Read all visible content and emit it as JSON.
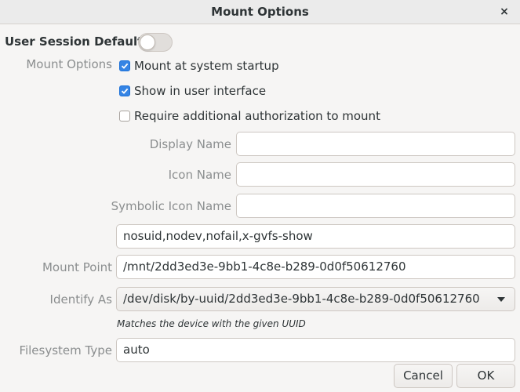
{
  "window": {
    "title": "Mount Options",
    "close_label": "×"
  },
  "session_defaults": {
    "label": "User Session Defaults",
    "enabled": false
  },
  "mount_options": {
    "section_label": "Mount Options",
    "checkboxes": [
      {
        "label": "Mount at system startup",
        "checked": true
      },
      {
        "label": "Show in user interface",
        "checked": true
      },
      {
        "label": "Require additional authorization to mount",
        "checked": false
      }
    ]
  },
  "fields": {
    "display_name": {
      "label": "Display Name",
      "value": ""
    },
    "icon_name": {
      "label": "Icon Name",
      "value": ""
    },
    "symbolic_icon_name": {
      "label": "Symbolic Icon Name",
      "value": ""
    },
    "options": {
      "value": "nosuid,nodev,nofail,x-gvfs-show"
    },
    "mount_point": {
      "label": "Mount Point",
      "value": "/mnt/2dd3ed3e-9bb1-4c8e-b289-0d0f50612760"
    },
    "identify_as": {
      "label": "Identify As",
      "value": "/dev/disk/by-uuid/2dd3ed3e-9bb1-4c8e-b289-0d0f50612760",
      "hint": "Matches the device with the given UUID"
    },
    "filesystem_type": {
      "label": "Filesystem Type",
      "value": "auto"
    }
  },
  "buttons": {
    "cancel": "Cancel",
    "ok": "OK"
  },
  "colors": {
    "accent": "#3584e4",
    "label_gray": "#8b8e8f",
    "background": "#f6f5f4"
  }
}
